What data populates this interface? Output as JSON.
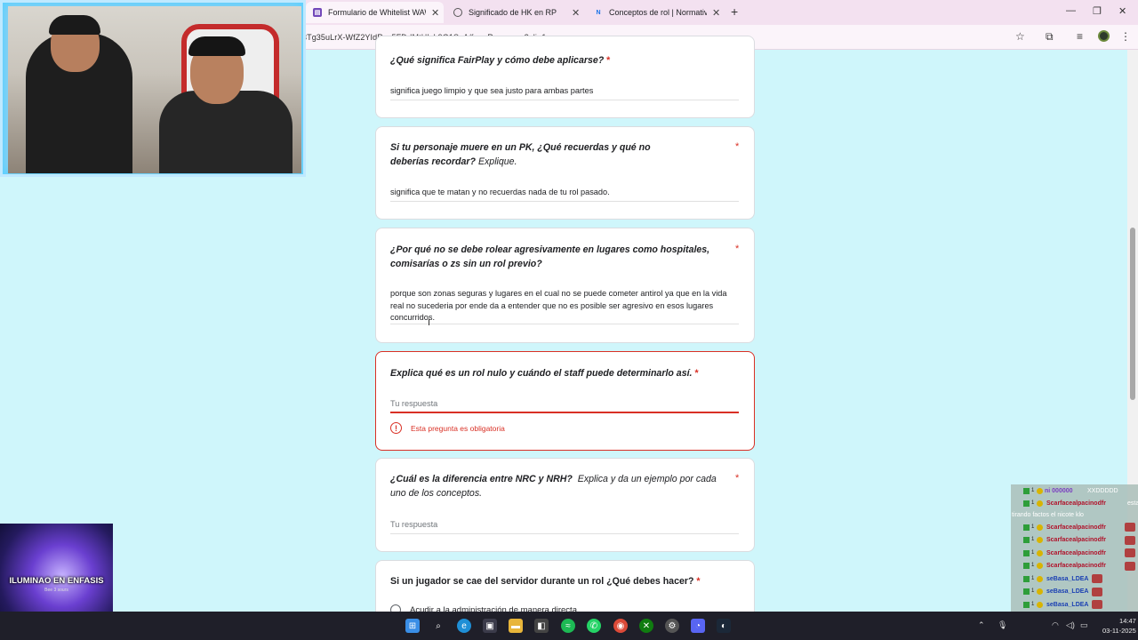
{
  "browser": {
    "tabs": [
      {
        "label": "Formulario de Whitelist WAWIT",
        "icon": "forms-icon",
        "active": true
      },
      {
        "label": "Significado de HK en RP",
        "icon": "globe-icon",
        "active": false
      },
      {
        "label": "Conceptos de rol | Normativas",
        "icon": "notion-icon",
        "active": false
      }
    ],
    "new_tab_glyph": "+",
    "url": "3Tg35uLrX-WfZ2YIdRvu5FDrIMtHIzL9G1SoA/formResponse?pli=1"
  },
  "form": {
    "q1": {
      "text": "¿Qué significa FairPlay y cómo debe aplicarse?",
      "required": "*",
      "answer": "significa juego limpio y que sea justo para ambas partes"
    },
    "q2": {
      "text_bold": "Si tu personaje muere en un PK, ¿Qué recuerdas y qué no deberías recordar?",
      "text_extra": "Explique.",
      "required": "*",
      "answer": "significa que te matan y no recuerdas nada de tu rol pasado."
    },
    "q3": {
      "text": "¿Por qué no se debe rolear agresivamente en lugares como hospitales, comisarías o zs sin un rol previo?",
      "required": "*",
      "answer": "porque son zonas seguras y lugares en el cual no se puede cometer antirol ya que en la vida real no sucederia por ende da a entender que no es posible ser agresivo en esos lugares concurridos."
    },
    "q4": {
      "text": "Explica qué es un rol nulo y cuándo el staff puede determinarlo así.",
      "required": "*",
      "placeholder": "Tu respuesta",
      "error": "Esta pregunta es obligatoria"
    },
    "q5": {
      "text_bold": "¿Cuál es la diferencia entre NRC y NRH?",
      "text_extra": "Explica y da un ejemplo por cada uno de los conceptos.",
      "required": "*",
      "placeholder": "Tu respuesta"
    },
    "q6": {
      "text": "Si un jugador se cae del servidor durante un rol ¿Qué debes hacer?",
      "required": "*",
      "option1": "Acudir a la administración de manera directa"
    }
  },
  "overlay": {
    "thumbnail_text": "ILUMINAO EN ENFASIS",
    "thumbnail_small": "Bee 3 sours"
  },
  "chat": {
    "rows": [
      {
        "name": "ni 000000",
        "message": "XXDDDDD",
        "color": "#7b3fc0"
      },
      {
        "name": "Scarfacealpacinodfr",
        "message": "esta",
        "color": "#b0122a"
      },
      {
        "name": "Scarfacealpacinodfr",
        "message": "",
        "color": "#b0122a"
      },
      {
        "name": "Scarfacealpacinodfr",
        "message": "",
        "color": "#b0122a"
      },
      {
        "name": "Scarfacealpacinodfr",
        "message": "",
        "color": "#b0122a"
      },
      {
        "name": "Scarfacealpacinodfr",
        "message": "",
        "color": "#b0122a"
      },
      {
        "name": "seBasa_LDEA",
        "message": "",
        "color": "#1a3fb3"
      },
      {
        "name": "seBasa_LDEA",
        "message": "",
        "color": "#1a3fb3"
      },
      {
        "name": "seBasa_LDEA",
        "message": "",
        "color": "#1a3fb3"
      }
    ],
    "wrap_line": "tirando factos el nicote klo"
  },
  "taskbar": {
    "time": "14:47",
    "date": "03-11-2025"
  },
  "colors": {
    "error": "#d93025",
    "page_bg": "#cff6fb",
    "tabbar": "#f3e1f0"
  }
}
